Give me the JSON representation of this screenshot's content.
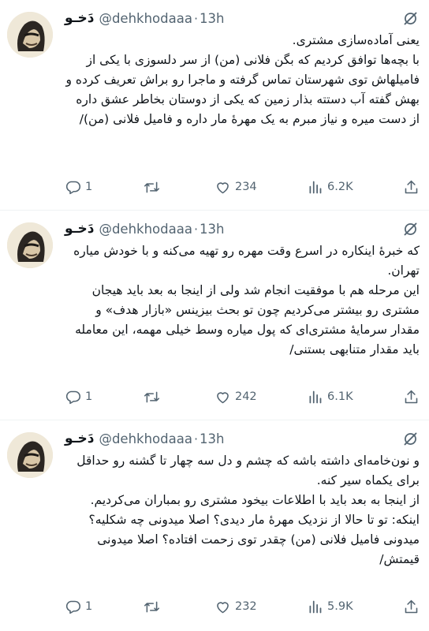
{
  "tweets": [
    {
      "display_name": "دَخـو",
      "handle": "@dehkhodaaa",
      "separator": "·",
      "time": "13h",
      "text": "یعنی آماده‌سازی مشتری.\nبا بچه‌ها توافق کردیم که بگن فلانی (من) از سر دلسوزی با یکی از فامیلهاش توی شهرستان تماس گرفته و ماجرا رو براش تعریف کرده و بهش گفته آب دستته بذار زمین که یکی از دوستان بخاطر عشق داره از دست میره و نیاز مبرم به یک مهرهٔ مار داره و فامیل فلانی (من)/",
      "replies": "1",
      "retweets": "",
      "likes": "234",
      "views": "6.2K"
    },
    {
      "display_name": "دَخـو",
      "handle": "@dehkhodaaa",
      "separator": "·",
      "time": "13h",
      "text": "که خبرهٔ اینکاره در اسرع وقت مهره رو تهیه می‌کنه و با خودش میاره تهران.\nاین مرحله هم با موفقیت انجام شد ولی از اینجا به بعد باید هیجان مشتری رو بیشتر می‌کردیم چون تو بحث بیزینس «بازار هدف» و مقدار سرمایهٔ مشتری‌ای که پول میاره وسط خیلی مهمه، این معامله باید مقدار متنابهی بستنی/",
      "replies": "1",
      "retweets": "",
      "likes": "242",
      "views": "6.1K"
    },
    {
      "display_name": "دَخـو",
      "handle": "@dehkhodaaa",
      "separator": "·",
      "time": "13h",
      "text": "و نون‌خامه‌ای داشته باشه که چشم و دل سه چهار تا گشنه رو حداقل برای یکماه سیر کنه.\nاز اینجا به بعد باید با اطلاعات بیخود مشتری رو بمباران می‌کردیم. اینکه: تو تا حالا از نزدیک مهرهٔ مار دیدی؟ اصلا میدونی چه شکلیه؟ میدونی فامیل فلانی (من) چقدر توی زحمت افتاده؟ اصلا میدونی قیمتش/",
      "replies": "1",
      "retweets": "",
      "likes": "232",
      "views": "5.9K"
    }
  ],
  "icons": {
    "grok": "grok-icon",
    "reply": "reply-icon",
    "retweet": "retweet-icon",
    "like": "heart-icon",
    "views": "views-icon",
    "share": "share-icon"
  },
  "colors": {
    "text": "#0f1419",
    "secondary": "#536471",
    "divider": "#eff3f4"
  }
}
